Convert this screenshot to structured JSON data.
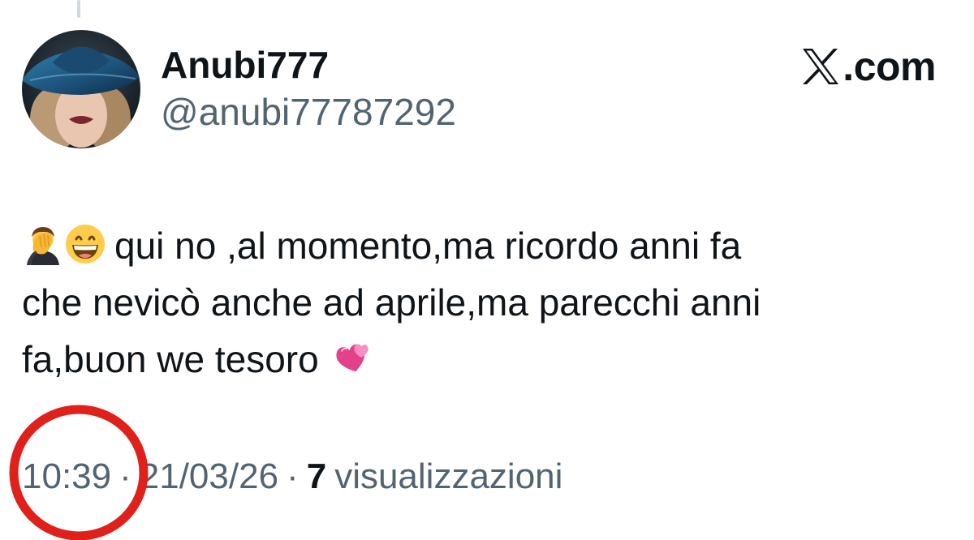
{
  "user": {
    "display_name": "Anubi777",
    "handle": "@anubi77787292"
  },
  "brand": {
    "name": ".com",
    "icon": "x-logo-icon"
  },
  "tweet": {
    "line1": "qui no ,al momento,ma ricordo anni fa",
    "line2": "che nevicò anche ad aprile,ma parecchi anni",
    "line3": "fa,buon we tesoro",
    "emojis": [
      "facepalm-emoji",
      "grinning-face-emoji",
      "two-hearts-emoji"
    ]
  },
  "meta": {
    "time": "10:39",
    "separator": "·",
    "date": "21/03/26",
    "views_count": "7",
    "views_label": "visualizzazioni"
  },
  "colors": {
    "text": "#0f1419",
    "secondary": "#536471",
    "annotation": "#e0201b"
  }
}
